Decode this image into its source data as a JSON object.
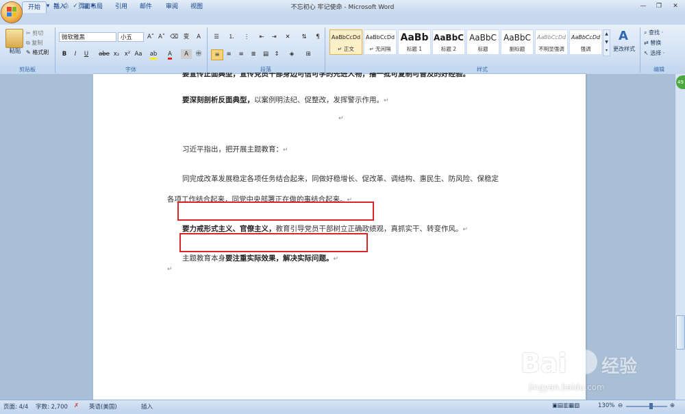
{
  "window": {
    "title": "不忘初心 牢记使命 - Microsoft Word"
  },
  "tabs": [
    "开始",
    "插入",
    "页面布局",
    "引用",
    "邮件",
    "审阅",
    "视图"
  ],
  "clipboard": {
    "paste": "粘贴",
    "cut": "剪切",
    "copy": "复制",
    "format_painter": "格式刷",
    "label": "剪贴板"
  },
  "font": {
    "name": "微软雅黑",
    "size": "小五",
    "label": "字体"
  },
  "paragraph": {
    "label": "段落"
  },
  "styles": {
    "label": "样式",
    "items": [
      {
        "sample": "AaBbCcDd",
        "name": "↵ 正文"
      },
      {
        "sample": "AaBbCcDd",
        "name": "↵ 无间隔"
      },
      {
        "sample": "AaBb",
        "name": "标题 1"
      },
      {
        "sample": "AaBbC",
        "name": "标题 2"
      },
      {
        "sample": "AaBbC",
        "name": "标题"
      },
      {
        "sample": "AaBbC",
        "name": "副标题"
      },
      {
        "sample": "AaBbCcDd",
        "name": "不明显强调"
      },
      {
        "sample": "AaBbCcDd",
        "name": "强调"
      }
    ],
    "change_styles": "更改样式"
  },
  "editing": {
    "find": "查找 ·",
    "replace": "替换",
    "select": "选择 ·",
    "label": "编辑"
  },
  "document": {
    "line0": "要宣传正面典型，宣传党员干部身边可信可学的先进人物，播一批可复制可普及的好经验。",
    "line1_bold": "要深刻剖析反面典型，",
    "line1_rest": "以案例明法纪、促整改，发挥警示作用。",
    "line2": "习近平指出，把开展主题教育：",
    "line3": "同完成改革发展稳定各项任务结合起来，同做好稳增长、促改革、调结构、惠民生、防风险、保稳定",
    "line4": "各项工作结合起来，同党中央部署正在做的事结合起来。",
    "line5_bold": "要力戒形式主义、官僚主义，",
    "line5_rest": "教育引导党员干部树立正确政绩观，真抓实干、转变作风。",
    "line6_pre": "主题教育本身",
    "line6_bold": "要注重实际效果，解决实际问题。",
    "para_mark": "↵"
  },
  "status": {
    "page": "页面: 4/4",
    "words": "字数: 2,700",
    "language": "英语(美国)",
    "mode": "插入",
    "zoom": "130%"
  },
  "side_badge": "49",
  "watermark": {
    "brand": "Bai",
    "brand2": "经验",
    "url": "jingyan.baidu.com"
  },
  "colors": {
    "highlight_red": "#d9242a",
    "ribbon_bg": "#cfdff3",
    "tab_text": "#15428b"
  }
}
